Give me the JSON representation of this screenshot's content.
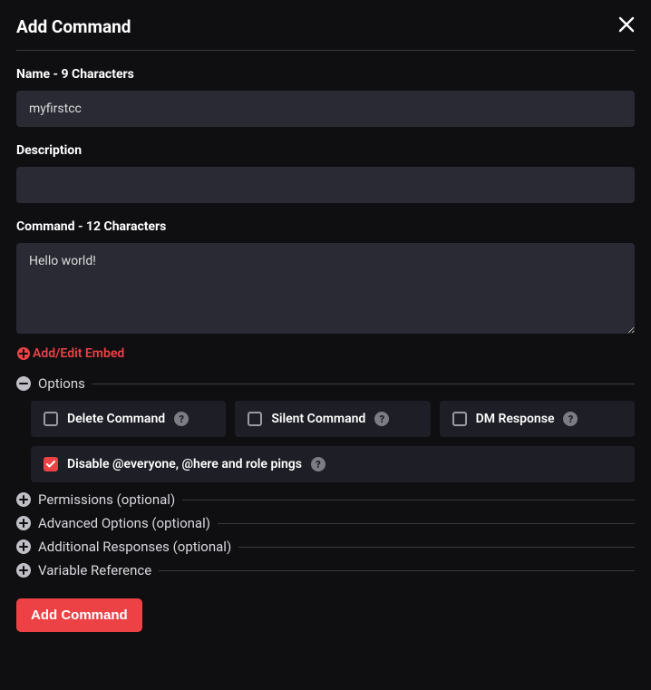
{
  "header": {
    "title": "Add Command"
  },
  "fields": {
    "name_label": "Name - 9 Characters",
    "name_value": "myfirstcc",
    "description_label": "Description",
    "description_value": "",
    "command_label": "Command - 12 Characters",
    "command_value": "Hello world!"
  },
  "embed_link": "Add/Edit Embed",
  "options_section": {
    "label": "Options",
    "delete_command": "Delete Command",
    "silent_command": "Silent Command",
    "dm_response": "DM Response",
    "disable_pings": "Disable @everyone, @here and role pings"
  },
  "sections": {
    "permissions": "Permissions (optional)",
    "advanced": "Advanced Options (optional)",
    "additional": "Additional Responses (optional)",
    "variable": "Variable Reference"
  },
  "submit_label": "Add Command"
}
